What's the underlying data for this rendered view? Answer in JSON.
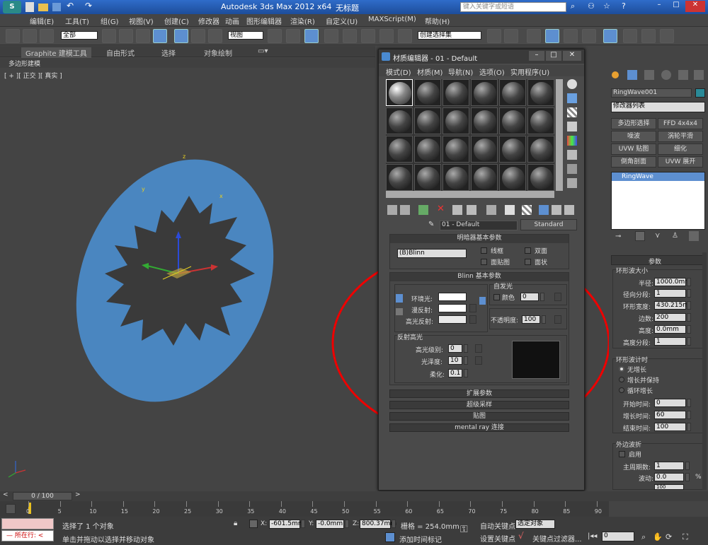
{
  "title_bar": {
    "app_title": "Autodesk 3ds Max  2012 x64",
    "doc_title": "无标题",
    "search_placeholder": "键入关键字或短语"
  },
  "menu": [
    "编辑(E)",
    "工具(T)",
    "组(G)",
    "视图(V)",
    "创建(C)",
    "修改器",
    "动画",
    "图形编辑器",
    "渲染(R)",
    "自定义(U)",
    "MAXScript(M)",
    "帮助(H)"
  ],
  "toolbar": {
    "selection_filter": "全部",
    "coord_system": "视图",
    "named_selection": "创建选择集"
  },
  "ribbon": {
    "tabs": [
      "Graphite 建模工具",
      "自由形式",
      "选择",
      "对象绘制"
    ],
    "sub": "多边形建模"
  },
  "viewport": {
    "label": "[ + ][ 正交 ][ 真实 ]",
    "axis_x": "x",
    "axis_y": "y",
    "axis_z": "z",
    "colors": {
      "ellipse": "#4a86c0",
      "shape": "#3a3a3a"
    }
  },
  "material_editor": {
    "title": "材质编辑器 - 01 - Default",
    "menu": [
      "模式(D)",
      "材质(M)",
      "导航(N)",
      "选项(O)",
      "实用程序(U)"
    ],
    "material_name": "01 - Default",
    "material_type": "Standard",
    "shader_rollout": "明暗器基本参数",
    "shader": "(B)Blinn",
    "checks": [
      "线框",
      "双面",
      "面贴图",
      "面状"
    ],
    "blinn_rollout": "Blinn 基本参数",
    "self_illum": "自发光",
    "color_label": "颜色",
    "color_value": "0",
    "ambient": "环境光:",
    "diffuse": "漫反射:",
    "specular": "高光反射:",
    "opacity_label": "不透明度:",
    "opacity": "100",
    "spec_highlights": "反射高光",
    "spec_level_label": "高光级别:",
    "spec_level": "0",
    "gloss_label": "光泽度:",
    "gloss": "10",
    "soften_label": "柔化:",
    "soften": "0.1",
    "rollouts": [
      "扩展参数",
      "超级采样",
      "贴图",
      "mental ray 连接"
    ]
  },
  "command_panel": {
    "object_name": "RingWave001",
    "modifier_list": "修改器列表",
    "buttons": [
      "多边形选择",
      "FFD 4x4x4",
      "噪波",
      "涡轮平滑",
      "UVW 贴图",
      "细化",
      "倒角剖面",
      "UVW 展开"
    ],
    "stack_item": "RingWave",
    "params_rollout": "参数",
    "ring_size": "环形波大小",
    "radius_label": "半径:",
    "radius": "1000.0mm",
    "radial_segs_label": "径向分段:",
    "radial_segs": "1",
    "ring_width_label": "环形宽度:",
    "ring_width": "430.215m",
    "sides_label": "边数:",
    "sides": "200",
    "height_label": "高度:",
    "height": "0.0mm",
    "height_segs_label": "高度分段:",
    "height_segs": "1",
    "timer": "环形波计时",
    "timer_opts": [
      "无增长",
      "增长并保持",
      "循环增长"
    ],
    "start_label": "开始时间:",
    "start": "0",
    "grow_label": "增长时间:",
    "grow": "60",
    "end_label": "结束时间:",
    "end": "100",
    "outer_edge": "外边波折",
    "enable": "启用",
    "major_label": "主周期数:",
    "major": "1",
    "wave_label": "波动:",
    "wave": "0.0",
    "wave_unit": "%",
    "extra_value": "100"
  },
  "timeline": {
    "frame": "0 / 100",
    "ticks": [
      "0",
      "5",
      "10",
      "15",
      "20",
      "25",
      "30",
      "35",
      "40",
      "45",
      "50",
      "55",
      "60",
      "65",
      "70",
      "75",
      "80",
      "85",
      "90"
    ]
  },
  "status": {
    "selected": "选择了 1 个对象",
    "hint": "单击并拖动以选择并移动对象",
    "mode": "所在行:",
    "x_label": "X:",
    "x": "-601.5mm",
    "y_label": "Y:",
    "y": "-0.0mm",
    "z_label": "Z:",
    "z": "800.37mm",
    "grid": "栅格 = 254.0mm",
    "autokey": "自动关键点",
    "selected_set": "选定对象",
    "setkey": "设置关键点",
    "keyfilter": "关键点过滤器...",
    "add_time_tag": "添加时间标记",
    "frame_value": "0"
  }
}
